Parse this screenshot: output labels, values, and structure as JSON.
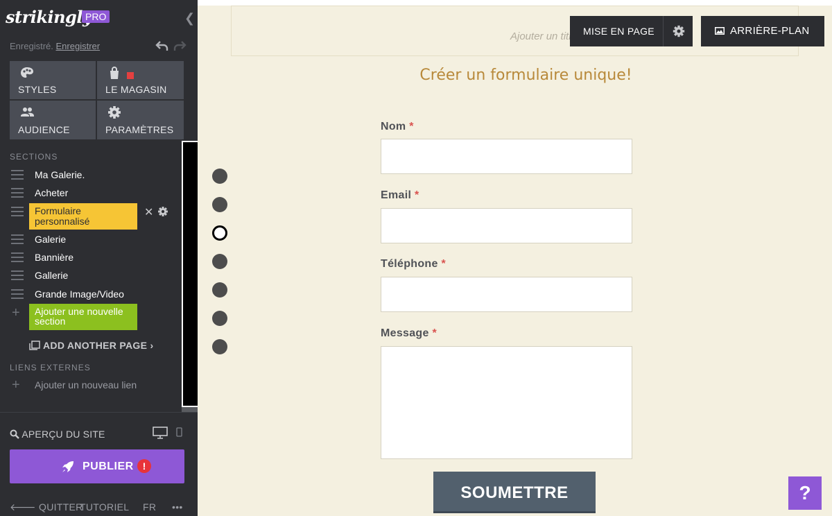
{
  "app": {
    "logo": "strikingly",
    "badge": "PRO"
  },
  "sidebar": {
    "save_status": "Enregistré.",
    "save_link": "Enregistrer",
    "main_buttons": [
      {
        "label": "STYLES",
        "icon": "palette-icon"
      },
      {
        "label": "LE MAGASIN",
        "icon": "shopping-bag-icon"
      },
      {
        "label": "AUDIENCE",
        "icon": "people-icon"
      },
      {
        "label": "PARAMÈTRES",
        "icon": "gear-icon"
      }
    ],
    "sections_heading": "SECTIONS",
    "sections": [
      {
        "label": "Ma Galerie."
      },
      {
        "label": "Acheter"
      },
      {
        "label": "Formulaire personnalisé",
        "active": true
      },
      {
        "label": "Galerie"
      },
      {
        "label": "Bannière"
      },
      {
        "label": "Gallerie"
      },
      {
        "label": "Grande Image/Video"
      }
    ],
    "add_section": "Ajouter une nouvelle section",
    "add_page": "ADD ANOTHER PAGE",
    "external_links_heading": "LIENS EXTERNES",
    "add_link": "Ajouter un nouveau lien",
    "preview": "APERÇU DU SITE",
    "publish": "PUBLIER",
    "publish_warning": "!",
    "bottom": {
      "quit": "QUITTER",
      "tutorial": "TUTORIEL",
      "lang": "FR",
      "more": "•••"
    }
  },
  "canvas": {
    "title_placeholder": "Ajouter un titre.",
    "layout_button": "MISE EN PAGE",
    "background_button": "ARRIÈRE-PLAN",
    "form_title": "Créer un formulaire unique!",
    "fields": [
      {
        "label": "Nom",
        "required": "*"
      },
      {
        "label": "Email",
        "required": "*"
      },
      {
        "label": "Téléphone",
        "required": "*"
      },
      {
        "label": "Message",
        "required": "*"
      }
    ],
    "submit": "SOUMETTRE",
    "nav_dots_count": 7,
    "active_dot_index": 2,
    "help": "?"
  },
  "colors": {
    "purple": "#8e58d6",
    "yellow": "#f6c535",
    "green": "#8cc01f",
    "gold_title": "#b8893a"
  }
}
